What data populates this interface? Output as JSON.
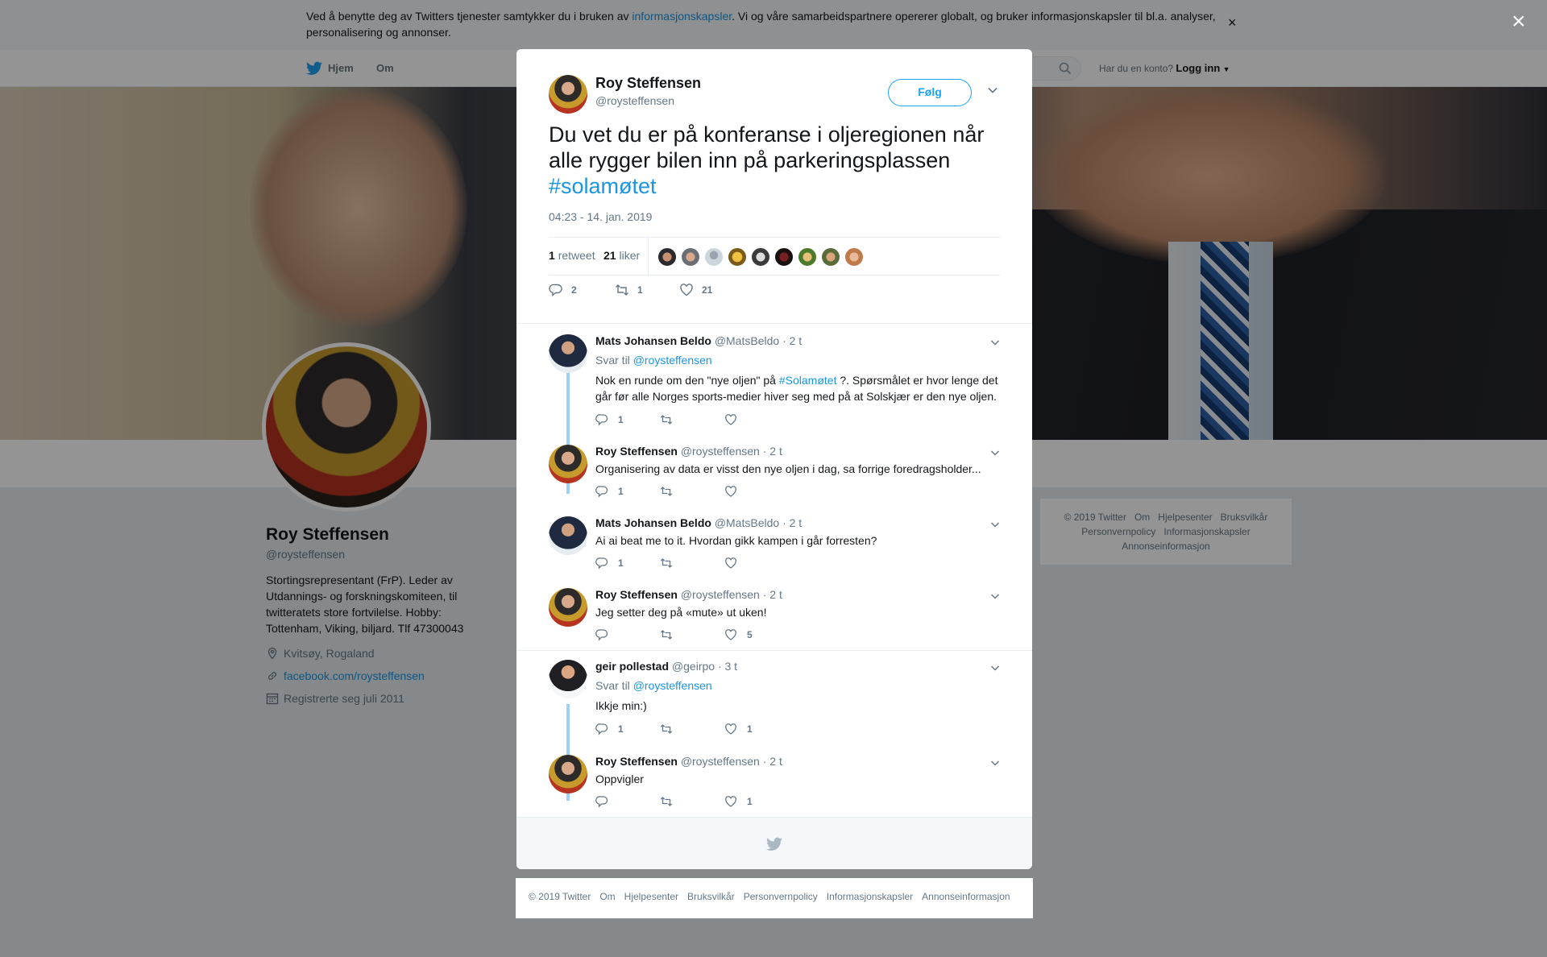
{
  "cookie": {
    "text_before": "Ved å benytte deg av Twitters tjenester samtykker du i bruken av ",
    "link": "informasjonskapsler",
    "text_after": ". Vi og våre samarbeidspartnere opererer globalt, og bruker informasjonskapsler til bl.a. analyser, personalisering og annonser.",
    "close": "×"
  },
  "nav": {
    "home": "Hjem",
    "about": "Om",
    "account_prompt": "Har du en konto?",
    "login": "Logg inn"
  },
  "profile": {
    "name": "Roy Steffensen",
    "handle": "@roysteffensen",
    "bio": "Stortingsrepresentant (FrP). Leder av Utdannings- og forskningskomiteen, til twitteratets store fortvilelse. Hobby: Tottenham, Viking, biljard. Tlf 47300043",
    "location": "Kvitsøy, Rogaland",
    "website": "facebook.com/roysteffensen",
    "joined": "Registrerte seg juli 2011"
  },
  "side_footer": [
    "© 2019 Twitter",
    "Om",
    "Hjelpesenter",
    "Bruksvilkår",
    "Personvernpolicy",
    "Informasjonskapsler",
    "Annonseinformasjon"
  ],
  "overlay_close": "×",
  "tweet": {
    "name": "Roy Steffensen",
    "handle": "@roysteffensen",
    "follow": "Følg",
    "text": "Du vet du er på konferanse i oljeregionen når alle rygger bilen inn på parkeringsplassen ",
    "hashtag": "#solamøtet",
    "time": "04:23 - 14. jan. 2019",
    "retweets_count": "1",
    "retweets_label": "retweet",
    "likes_count": "21",
    "likes_label": "liker",
    "reply_action": "2",
    "retweet_action": "1",
    "like_action": "21"
  },
  "replies": [
    {
      "name": "Mats Johansen Beldo",
      "handle": "@MatsBeldo",
      "time": "· 2 t",
      "reply_to_label": "Svar til ",
      "reply_to": "@roysteffensen",
      "text_before": "Nok en runde om den \"nye oljen\" på ",
      "hashtag": "#Solamøtet",
      "text_after": " ?. Spørsmålet er hvor lenge det går før alle Norges sports-medier hiver seg med på at Solskjær er den nye oljen.",
      "replies": "1",
      "retweets": "",
      "likes": ""
    },
    {
      "name": "Roy Steffensen",
      "handle": "@roysteffensen",
      "time": "· 2 t",
      "text": "Organisering av data er visst den nye oljen i dag, sa forrige foredragsholder...",
      "replies": "1",
      "retweets": "",
      "likes": ""
    },
    {
      "name": "Mats Johansen Beldo",
      "handle": "@MatsBeldo",
      "time": "· 2 t",
      "text": "Ai ai beat me to it. Hvordan gikk kampen i går forresten?",
      "replies": "1",
      "retweets": "",
      "likes": ""
    },
    {
      "name": "Roy Steffensen",
      "handle": "@roysteffensen",
      "time": "· 2 t",
      "text": "Jeg setter deg på «mute» ut uken!",
      "replies": "",
      "retweets": "",
      "likes": "5"
    },
    {
      "name": "geir pollestad",
      "handle": "@geirpo",
      "time": "· 3 t",
      "reply_to_label": "Svar til ",
      "reply_to": "@roysteffensen",
      "text": "Ikkje min:)",
      "replies": "1",
      "retweets": "",
      "likes": "1"
    },
    {
      "name": "Roy Steffensen",
      "handle": "@roysteffensen",
      "time": "· 2 t",
      "text": "Oppvigler",
      "replies": "",
      "retweets": "",
      "likes": "1"
    }
  ],
  "bottom_footer": [
    "© 2019 Twitter",
    "Om",
    "Hjelpesenter",
    "Bruksvilkår",
    "Personvernpolicy",
    "Informasjonskapsler",
    "Annonseinformasjon"
  ],
  "colors": {
    "accent": "#1da1f2",
    "link": "#1b95e0",
    "thread": "#9fd0f5",
    "muted": "#657786"
  },
  "icons": [
    "twitter-bird-icon",
    "search-icon",
    "chevron-down-icon",
    "reply-icon",
    "retweet-icon",
    "heart-icon",
    "location-icon",
    "link-icon",
    "calendar-icon",
    "close-icon"
  ]
}
